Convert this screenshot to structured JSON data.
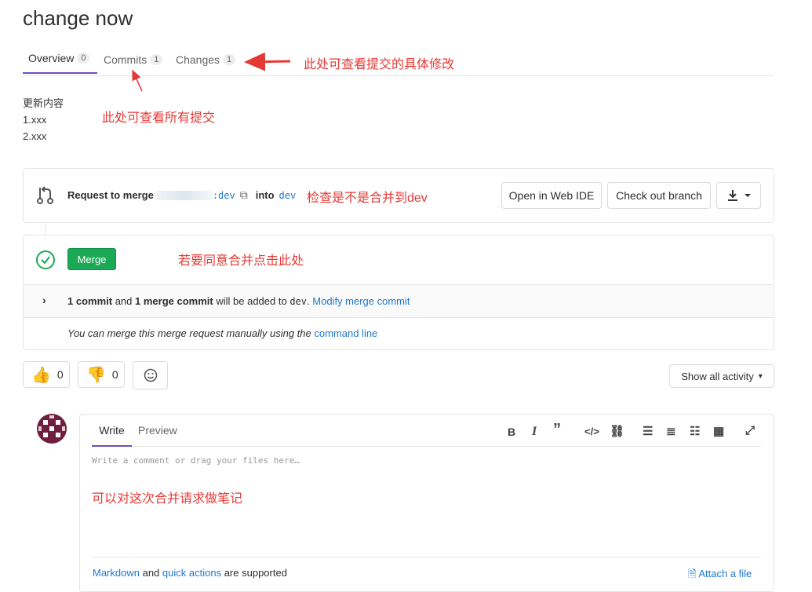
{
  "title": "change now",
  "tabs": [
    {
      "label": "Overview",
      "count": "0"
    },
    {
      "label": "Commits",
      "count": "1"
    },
    {
      "label": "Changes",
      "count": "1"
    }
  ],
  "annotations": {
    "changes": "此处可查看提交的具体修改",
    "commits": "此处可查看所有提交",
    "check": "检查是不是合并到dev",
    "merge": "若要同意合并点击此处",
    "note": "可以对这次合并请求做笔记"
  },
  "description": [
    "更新内容",
    "1.xxx",
    "2.xxx"
  ],
  "request": {
    "prefix": "Request to merge",
    "source_suffix": ":dev",
    "into": "into",
    "target": "dev",
    "open_web_ide": "Open in Web IDE",
    "checkout": "Check out branch"
  },
  "merge": {
    "button": "Merge",
    "commits_bold": "1 commit",
    "and": "and",
    "merge_commit_bold": "1 merge commit",
    "added_to": "will be added to",
    "branch": "dev",
    "period": ".",
    "modify_link": "Modify merge commit",
    "manual_text": "You can merge this merge request manually using the",
    "command_line": "command line"
  },
  "reactions": {
    "thumbs_up": "0",
    "thumbs_down": "0"
  },
  "activity_label": "Show all activity",
  "comment": {
    "write_tab": "Write",
    "preview_tab": "Preview",
    "placeholder": "Write a comment or drag your files here…",
    "markdown": "Markdown",
    "and": "and",
    "quick_actions": "quick actions",
    "supported": "are supported",
    "attach": "Attach a file"
  },
  "colors": {
    "accent": "#6b4fbb",
    "success": "#1aaa55",
    "link": "#1f78d1",
    "annotation": "#e53935"
  }
}
